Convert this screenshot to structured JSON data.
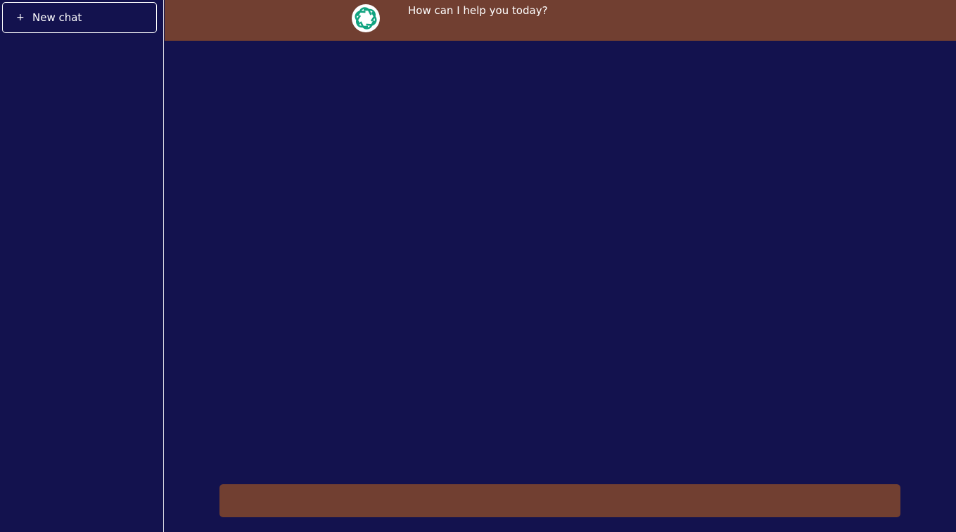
{
  "sidebar": {
    "new_chat_icon": "+",
    "new_chat_label": "New chat"
  },
  "conversation": {
    "messages": [
      {
        "role": "assistant",
        "avatar_icon": "openai-logo-icon",
        "text": "How can I help you today?"
      }
    ]
  },
  "composer": {
    "value": "",
    "placeholder": ""
  },
  "colors": {
    "background": "#13124e",
    "message_bar": "#713f31",
    "input_bar": "#713f31",
    "logo_green": "#10a37f",
    "text": "#ffffff"
  }
}
